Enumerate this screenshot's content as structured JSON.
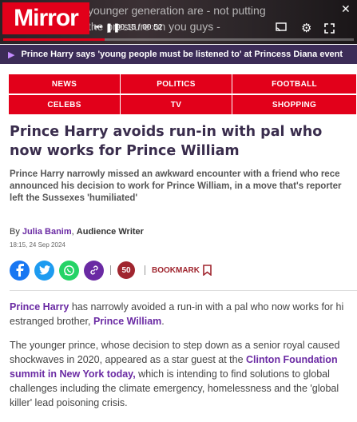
{
  "video": {
    "caption_line1": "younger generation are - not putting",
    "caption_line2": "the pressure on you guys -",
    "time": "00:15 / 00:52",
    "progress_fraction": 0.29
  },
  "brand": {
    "logo_text": "Mirror",
    "color": "#e2001a"
  },
  "related": {
    "text": "Prince Harry says 'young people must be listened to' at Princess Diana event"
  },
  "nav": {
    "items": [
      "NEWS",
      "POLITICS",
      "FOOTBALL",
      "CELEBS",
      "TV",
      "SHOPPING"
    ]
  },
  "article": {
    "headline": "Prince Harry avoids run-in with pal who now works for Prince William",
    "standfirst_lines": [
      "Prince Harry narrowly missed an awkward encounter with a friend who rece",
      "announced his decision to work for Prince William, in a move that's reporter",
      "left the Sussexes 'humiliated'"
    ],
    "byline_prefix": "By",
    "author": "Julia Banim",
    "role": "Audience Writer",
    "timestamp": "18:15, 24 Sep 2024",
    "comment_count": "50",
    "bookmark_label": "BOOKMARK",
    "p1": {
      "link1": "Prince Harry",
      "text1": " has narrowly avoided a run-in with a pal who now works for hi",
      "text2": "estranged brother, ",
      "link2": "Prince William",
      "text3": "."
    },
    "p2": {
      "l1": "The younger prince, whose decision to step down as a senior royal caused",
      "l2a": "shockwaves in 2020, appeared as a star guest at the ",
      "l2link": "Clinton Foundation",
      "l3link": "summit in New York today,",
      "l3b": " which is intending to find solutions to global",
      "l4": "challenges including the climate emergency, homelessness and the 'global",
      "l5": "killer' lead poisoning crisis."
    }
  },
  "colors": {
    "nav_red": "#e2001a",
    "related_purple": "#3c2c57",
    "link_purple": "#6a2aa3",
    "headline": "#3a2d4d",
    "facebook": "#1877f2",
    "twitter": "#1d9bf0",
    "whatsapp": "#25d366",
    "share_link": "#6a2aa3",
    "comment": "#a0262f"
  }
}
